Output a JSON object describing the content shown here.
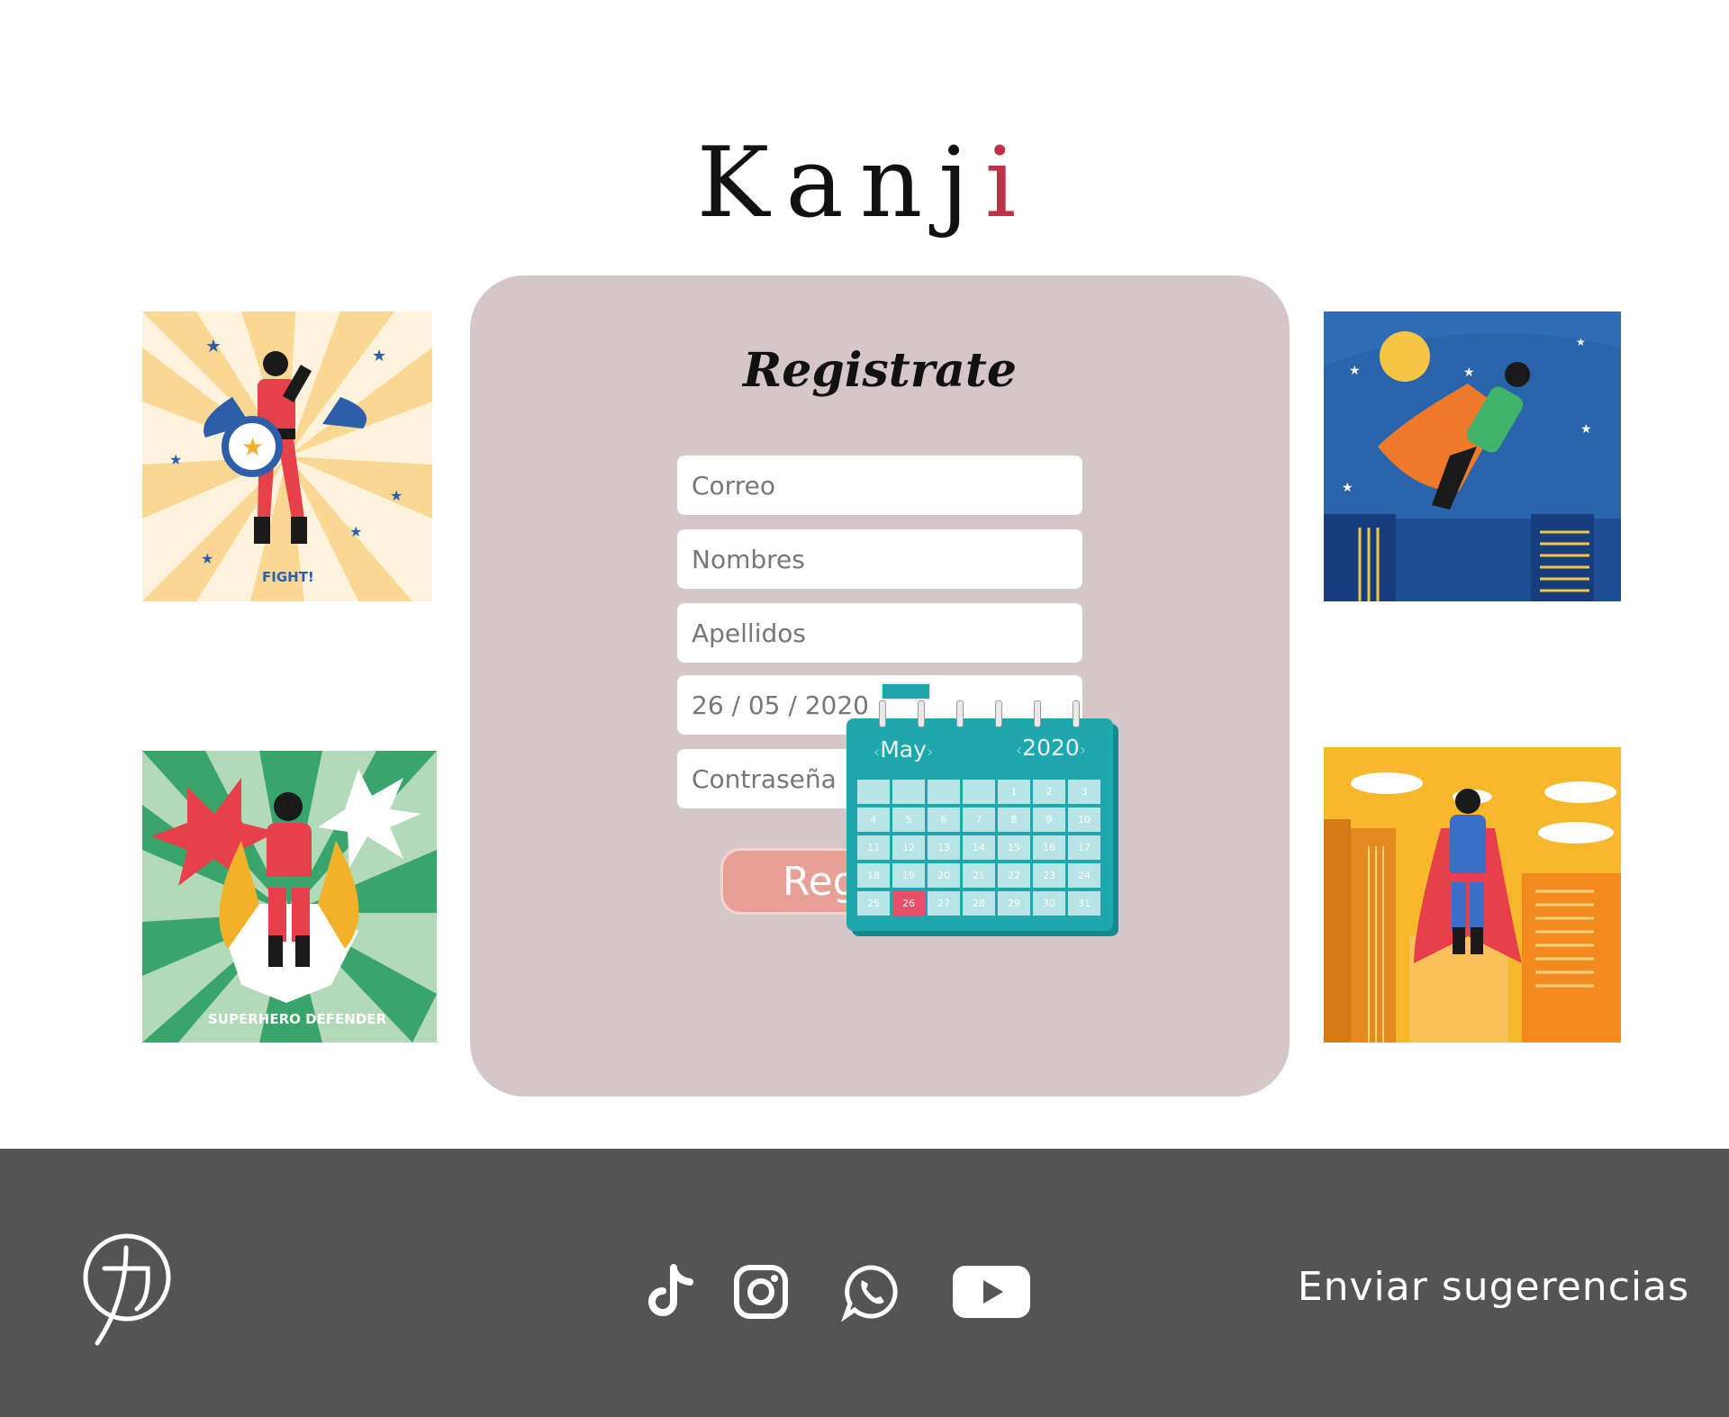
{
  "app": {
    "brand": "Kanj",
    "brand_dot": "i"
  },
  "form": {
    "title": "Registrate",
    "fields": {
      "email_placeholder": "Correo",
      "names_placeholder": "Nombres",
      "surnames_placeholder": "Apellidos",
      "birthdate_value": "26 / 05 / 2020",
      "password_placeholder": "Contraseña"
    },
    "submit_label": "Reg"
  },
  "calendar": {
    "month": "May",
    "year": "2020",
    "days": [
      "",
      "",
      "",
      "",
      "1",
      "2",
      "3",
      "4",
      "5",
      "6",
      "7",
      "8",
      "9",
      "10",
      "11",
      "12",
      "13",
      "14",
      "15",
      "16",
      "17",
      "18",
      "19",
      "20",
      "21",
      "22",
      "23",
      "24",
      "25",
      "26",
      "27",
      "28",
      "29",
      "30",
      "31"
    ],
    "selected_day": "26",
    "colors": {
      "body": "#1ea7ad",
      "cell": "#b8e4e6",
      "selected": "#e8506a"
    }
  },
  "illustrations": {
    "top_left_caption": "FIGHT!",
    "bottom_left_caption": "SUPERHERO DEFENDER"
  },
  "footer": {
    "logo_icon": "kanji-chikara-logo-icon",
    "social": [
      {
        "icon": "tiktok-icon"
      },
      {
        "icon": "instagram-icon"
      },
      {
        "icon": "whatsapp-icon"
      },
      {
        "icon": "youtube-icon"
      }
    ],
    "suggestions_label": "Enviar sugerencias"
  },
  "colors": {
    "card_bg": "#d5c6ca",
    "footer_bg": "#545454",
    "button_bg": "#e8a096",
    "brand_dot": "#c0304a"
  }
}
